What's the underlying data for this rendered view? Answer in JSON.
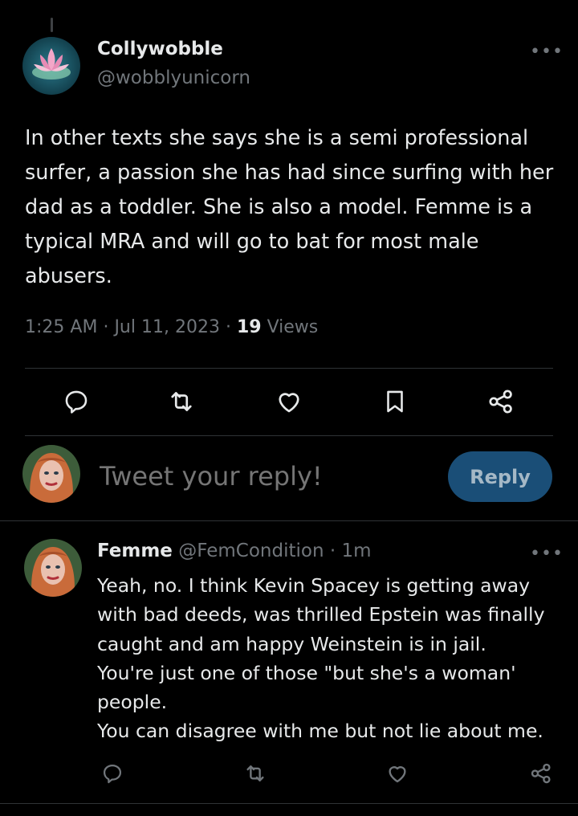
{
  "tweet": {
    "author_name": "Collywobble",
    "author_handle": "@wobblyunicorn",
    "text": "In other texts she says she is a semi professional surfer, a passion she has had since surfing with her dad as a toddler. She is also a model. Femme is a typical MRA and will go to bat for most male abusers.",
    "time": "1:25 AM",
    "date": "Jul 11, 2023",
    "views_count": "19",
    "views_label": "Views"
  },
  "composer": {
    "placeholder": "Tweet your reply!",
    "reply_label": "Reply"
  },
  "reply": {
    "author_name": "Femme",
    "author_handle": "@FemCondition",
    "age": "1m",
    "lines": [
      "Yeah, no. I think Kevin Spacey is getting away",
      "with bad deeds, was thrilled Epstein was finally",
      "caught and am happy Weinstein is in jail.",
      "You're just one of those \"but she's a woman'",
      "people.",
      "You can disagree with me but not lie about me."
    ]
  },
  "icons": {
    "more": "more-icon",
    "reply": "reply-icon",
    "retweet": "retweet-icon",
    "like": "like-icon",
    "bookmark": "bookmark-icon",
    "share": "share-icon"
  },
  "colors": {
    "background": "#000000",
    "text": "#e7e9ea",
    "secondary": "#71767b",
    "reply_button": "#1a4e77",
    "divider": "#2f3336"
  }
}
